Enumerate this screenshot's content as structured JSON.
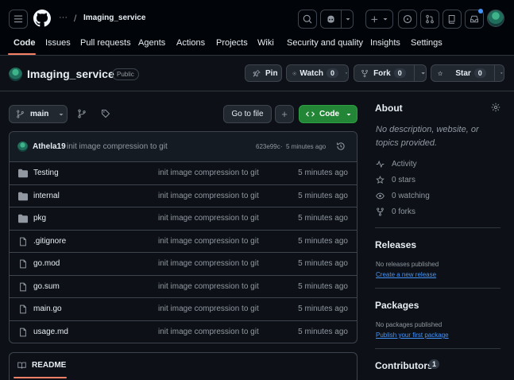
{
  "header": {
    "owner_separator": "/",
    "owner_ellipsis": "···",
    "repo_name": "Imaging_service"
  },
  "nav": {
    "tabs": [
      {
        "label": "Code"
      },
      {
        "label": "Issues"
      },
      {
        "label": "Pull requests"
      },
      {
        "label": "Agents"
      },
      {
        "label": "Actions"
      },
      {
        "label": "Projects"
      },
      {
        "label": "Wiki"
      },
      {
        "label": "Security and quality"
      },
      {
        "label": "Insights"
      },
      {
        "label": "Settings"
      }
    ]
  },
  "repo": {
    "name": "Imaging_service",
    "visibility": "Public",
    "pin_label": "Pin",
    "watch_label": "Watch",
    "watch_count": "0",
    "fork_label": "Fork",
    "fork_count": "0",
    "star_label": "Star",
    "star_count": "0"
  },
  "toolbar": {
    "branch": "main",
    "goto_file": "Go to file",
    "add": "+",
    "code": "Code"
  },
  "latest_commit": {
    "author": "Athela19",
    "message": "init image compression to git",
    "hash": "623e99c",
    "sep": " · ",
    "time": "5 minutes ago"
  },
  "files": [
    {
      "type": "folder",
      "name": "Testing",
      "commit": "init image compression to git",
      "date": "5 minutes ago"
    },
    {
      "type": "folder",
      "name": "internal",
      "commit": "init image compression to git",
      "date": "5 minutes ago"
    },
    {
      "type": "folder",
      "name": "pkg",
      "commit": "init image compression to git",
      "date": "5 minutes ago"
    },
    {
      "type": "file",
      "name": ".gitignore",
      "commit": "init image compression to git",
      "date": "5 minutes ago"
    },
    {
      "type": "file",
      "name": "go.mod",
      "commit": "init image compression to git",
      "date": "5 minutes ago"
    },
    {
      "type": "file",
      "name": "go.sum",
      "commit": "init image compression to git",
      "date": "5 minutes ago"
    },
    {
      "type": "file",
      "name": "main.go",
      "commit": "init image compression to git",
      "date": "5 minutes ago"
    },
    {
      "type": "file",
      "name": "usage.md",
      "commit": "init image compression to git",
      "date": "5 minutes ago"
    }
  ],
  "readme": {
    "label": "README"
  },
  "about": {
    "title": "About",
    "description": "No description, website, or topics provided.",
    "activity": "Activity",
    "stars": "0 stars",
    "watching": "0 watching",
    "forks": "0 forks"
  },
  "releases": {
    "title": "Releases",
    "empty": "No releases published",
    "link": "Create a new release"
  },
  "packages": {
    "title": "Packages",
    "empty": "No packages published",
    "link": "Publish your first package"
  },
  "contributors": {
    "title": "Contributors",
    "count": "1"
  },
  "colors": {
    "background": "#0d1117",
    "header_bg": "#010409",
    "accent_green": "#238636",
    "link_blue": "#4493f8",
    "tab_underline": "#f78166"
  }
}
